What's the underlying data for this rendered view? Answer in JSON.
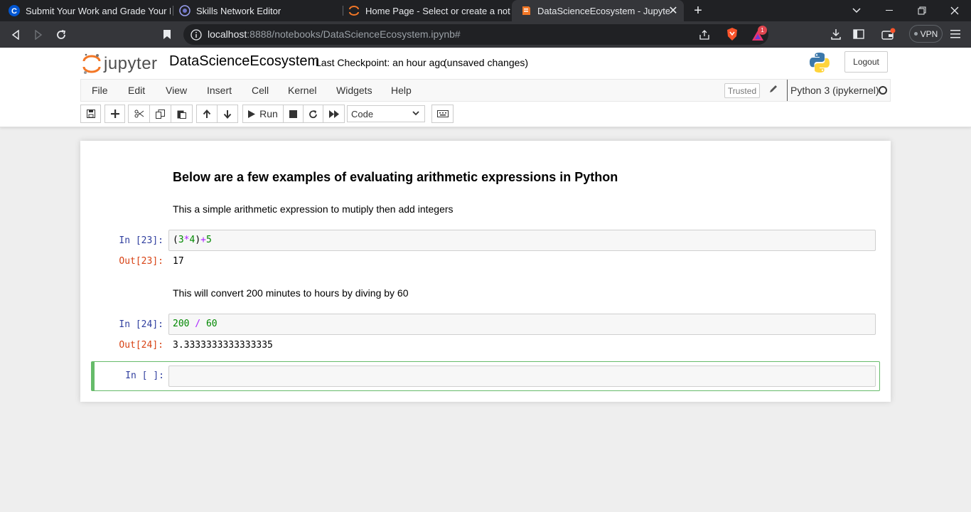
{
  "browser": {
    "tabs": [
      {
        "title": "Submit Your Work and Grade Your Pee",
        "icon": "coursera-icon"
      },
      {
        "title": "Skills Network Editor",
        "icon": "skills-network-icon"
      },
      {
        "title": "Home Page - Select or create a notebo",
        "icon": "jupyter-icon"
      },
      {
        "title": "DataScienceEcosystem - Jupyter N",
        "icon": "notebook-icon"
      }
    ],
    "url_host": "localhost",
    "url_rest": ":8888/notebooks/DataScienceEcosystem.ipynb#",
    "notification_count": "1",
    "vpn_label": "VPN"
  },
  "header": {
    "logo_text": "jupyter",
    "notebook_name": "DataScienceEcosystem",
    "checkpoint": "Last Checkpoint: an hour ago",
    "autosave": "(unsaved changes)",
    "logout_label": "Logout"
  },
  "menubar": {
    "items": [
      "File",
      "Edit",
      "View",
      "Insert",
      "Cell",
      "Kernel",
      "Widgets",
      "Help"
    ],
    "trusted": "Trusted",
    "kernel": "Python 3 (ipykernel)"
  },
  "toolbar": {
    "run_label": "Run",
    "cell_type": "Code"
  },
  "cells": {
    "heading": "Below are a few examples of evaluating arithmetic expressions in Python",
    "para1": "This a simple arithmetic expression to mutiply then add integers",
    "in1_prompt": "In [23]:",
    "in1_code": [
      "(",
      "3",
      "*",
      "4",
      ")",
      "+",
      "5"
    ],
    "out1_prompt": "Out[23]:",
    "out1_value": "17",
    "para2": "This will convert 200 minutes to hours by diving by 60",
    "in2_prompt": "In [24]:",
    "in2_code": [
      "200",
      " / ",
      "60"
    ],
    "out2_prompt": "Out[24]:",
    "out2_value": "3.3333333333333335",
    "in3_prompt": "In [ ]:"
  },
  "colors": {
    "browser_bg": "#202124",
    "active_tab": "#35363a",
    "prompt_in": "#303f9f",
    "prompt_out": "#d84315",
    "selected_cell_border": "#66bb6a"
  }
}
